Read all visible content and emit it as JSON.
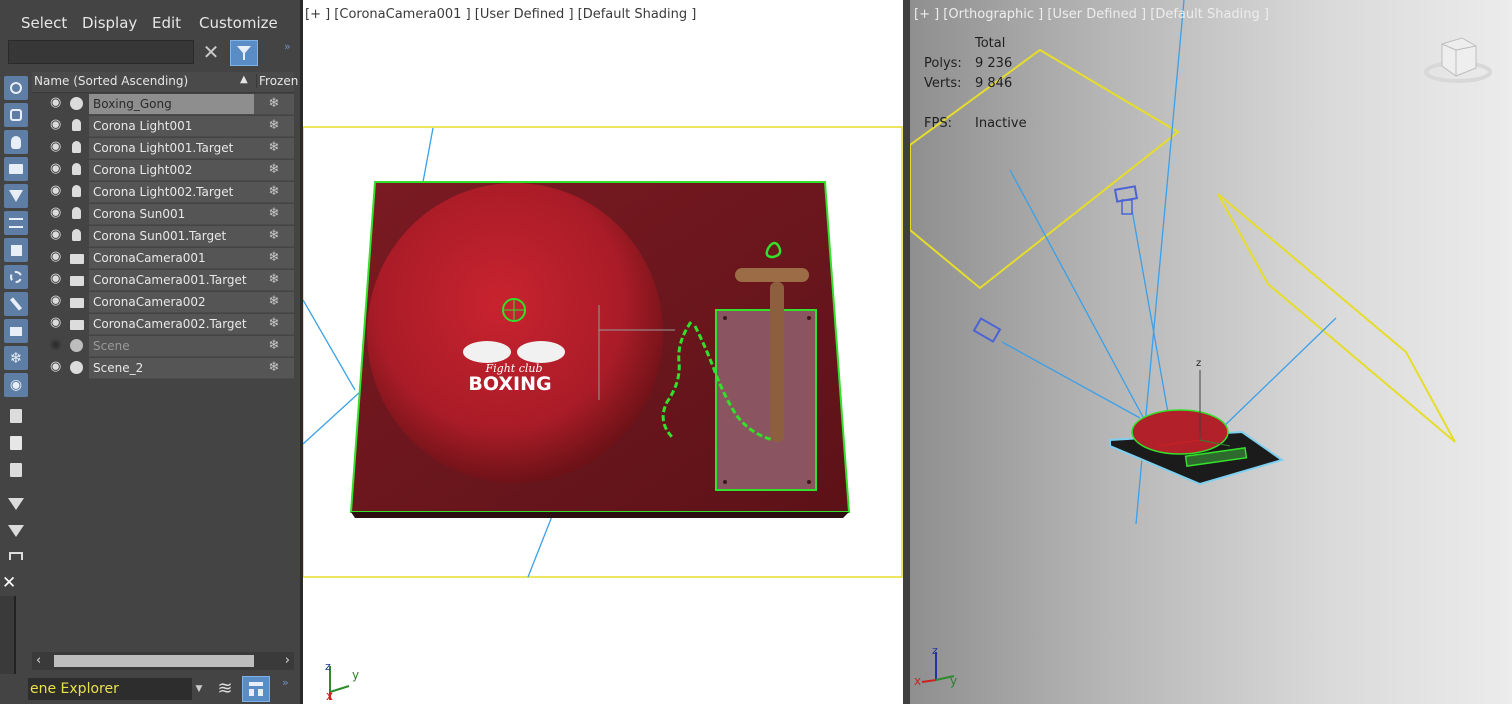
{
  "menu": {
    "select": "Select",
    "display": "Display",
    "edit": "Edit",
    "customize": "Customize"
  },
  "search": {
    "value": "",
    "placeholder": ""
  },
  "tree": {
    "col_name": "Name (Sorted Ascending)",
    "col_frozen": "Frozen",
    "rows": [
      {
        "name": "Boxing_Gong",
        "type": "geometry",
        "selected": true
      },
      {
        "name": "Corona Light001",
        "type": "light"
      },
      {
        "name": "Corona Light001.Target",
        "type": "light"
      },
      {
        "name": "Corona Light002",
        "type": "light"
      },
      {
        "name": "Corona Light002.Target",
        "type": "light"
      },
      {
        "name": "Corona Sun001",
        "type": "light"
      },
      {
        "name": "Corona Sun001.Target",
        "type": "light"
      },
      {
        "name": "CoronaCamera001",
        "type": "camera"
      },
      {
        "name": "CoronaCamera001.Target",
        "type": "camera"
      },
      {
        "name": "CoronaCamera002",
        "type": "camera"
      },
      {
        "name": "CoronaCamera002.Target",
        "type": "camera"
      },
      {
        "name": "Scene",
        "type": "geometry",
        "hidden": true
      },
      {
        "name": "Scene_2",
        "type": "geometry"
      }
    ]
  },
  "bottom": {
    "explorer_name": "ene Explorer"
  },
  "viewport_camera": {
    "label": "[+ ] [CoronaCamera001 ] [User Defined ] [Default Shading ]",
    "logo_top": "Fight club",
    "logo_main": "BOXING"
  },
  "viewport_ortho": {
    "label": "[+ ] [Orthographic ] [User Defined ] [Default Shading ]",
    "stats_header": "Total",
    "polys_label": "Polys:",
    "polys_value": "9 236",
    "verts_label": "Verts:",
    "verts_value": "9 846",
    "fps_label": "FPS:",
    "fps_value": "Inactive"
  },
  "axes": {
    "x": "x",
    "y": "y",
    "z": "z"
  },
  "colors": {
    "panel": "#444444",
    "selection_green": "#33e02a",
    "frame_yellow": "#e6dd2a",
    "light_blue": "#3aa0e8",
    "gong_red": "#b2202a",
    "base_wood": "#7a1c22"
  }
}
